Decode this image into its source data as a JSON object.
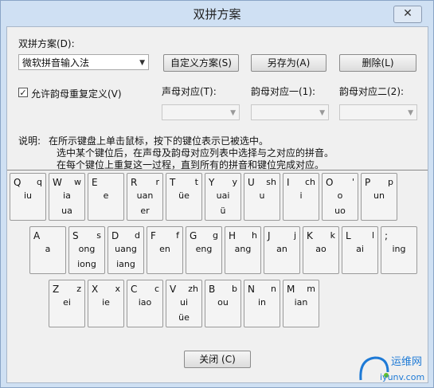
{
  "window": {
    "title": "双拼方案",
    "close_glyph": "✕"
  },
  "scheme": {
    "label": "双拼方案(D):",
    "selected": "微软拼音输入法",
    "buttons": {
      "custom": "自定义方案(S)",
      "save_as": "另存为(A)",
      "delete": "删除(L)"
    }
  },
  "options": {
    "allow_repeat_label": "允许韵母重复定义(V)",
    "allow_repeat_checked": true
  },
  "mapping": {
    "initial_label": "声母对应(T):",
    "final1_label": "韵母对应一(1):",
    "final2_label": "韵母对应二(2):"
  },
  "help": {
    "prefix": "说明:",
    "line1": "在所示键盘上单击鼠标，按下的键位表示已被选中。",
    "line2": "选中某个键位后，在声母及韵母对应列表中选择与之对应的拼音。",
    "line3": "在每个键位上重复这一过程，直到所有的拼音和键位完成对应。"
  },
  "keyboard": {
    "row1": [
      {
        "key": "Q",
        "initial": "q",
        "f1": "iu",
        "f2": ""
      },
      {
        "key": "W",
        "initial": "w",
        "f1": "ia",
        "f2": "ua"
      },
      {
        "key": "E",
        "initial": "",
        "f1": "e",
        "f2": ""
      },
      {
        "key": "R",
        "initial": "r",
        "f1": "uan",
        "f2": "er"
      },
      {
        "key": "T",
        "initial": "t",
        "f1": "üe",
        "f2": ""
      },
      {
        "key": "Y",
        "initial": "y",
        "f1": "uai",
        "f2": "ü"
      },
      {
        "key": "U",
        "initial": "sh",
        "f1": "u",
        "f2": ""
      },
      {
        "key": "I",
        "initial": "ch",
        "f1": "i",
        "f2": ""
      },
      {
        "key": "O",
        "initial": "'",
        "f1": "o",
        "f2": "uo"
      },
      {
        "key": "P",
        "initial": "p",
        "f1": "un",
        "f2": ""
      }
    ],
    "row2": [
      {
        "key": "A",
        "initial": "",
        "f1": "a",
        "f2": ""
      },
      {
        "key": "S",
        "initial": "s",
        "f1": "ong",
        "f2": "iong"
      },
      {
        "key": "D",
        "initial": "d",
        "f1": "uang",
        "f2": "iang"
      },
      {
        "key": "F",
        "initial": "f",
        "f1": "en",
        "f2": ""
      },
      {
        "key": "G",
        "initial": "g",
        "f1": "eng",
        "f2": ""
      },
      {
        "key": "H",
        "initial": "h",
        "f1": "ang",
        "f2": ""
      },
      {
        "key": "J",
        "initial": "j",
        "f1": "an",
        "f2": ""
      },
      {
        "key": "K",
        "initial": "k",
        "f1": "ao",
        "f2": ""
      },
      {
        "key": "L",
        "initial": "l",
        "f1": "ai",
        "f2": ""
      },
      {
        "key": ";",
        "initial": "",
        "f1": "ing",
        "f2": ""
      }
    ],
    "row3": [
      {
        "key": "Z",
        "initial": "z",
        "f1": "ei",
        "f2": ""
      },
      {
        "key": "X",
        "initial": "x",
        "f1": "ie",
        "f2": ""
      },
      {
        "key": "C",
        "initial": "c",
        "f1": "iao",
        "f2": ""
      },
      {
        "key": "V",
        "initial": "zh",
        "f1": "ui",
        "f2": "üe"
      },
      {
        "key": "B",
        "initial": "b",
        "f1": "ou",
        "f2": ""
      },
      {
        "key": "N",
        "initial": "n",
        "f1": "in",
        "f2": ""
      },
      {
        "key": "M",
        "initial": "m",
        "f1": "ian",
        "f2": ""
      }
    ]
  },
  "footer": {
    "close_label": "关闭 (C)"
  },
  "watermark": {
    "text1": "运维网",
    "text2": "iyunv.com",
    "brand_color": "#1e7ad6"
  }
}
